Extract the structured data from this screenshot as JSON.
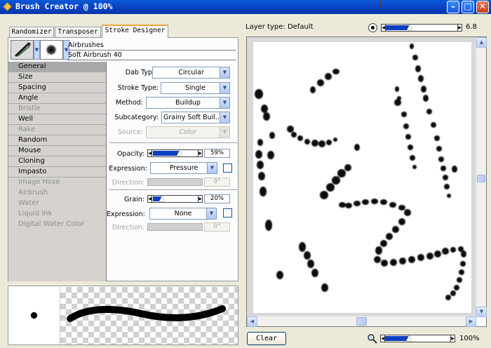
{
  "window": {
    "title": "Brush Creator @ 100%"
  },
  "tabs": [
    "Randomizer",
    "Transposer",
    "Stroke Designer"
  ],
  "brush": {
    "category": "Airbrushes",
    "variant": "Soft Airbrush 40"
  },
  "categories": [
    {
      "label": "General",
      "state": "selected"
    },
    {
      "label": "Size",
      "state": "enabled"
    },
    {
      "label": "Spacing",
      "state": "enabled"
    },
    {
      "label": "Angle",
      "state": "enabled"
    },
    {
      "label": "Bristle",
      "state": "disabled"
    },
    {
      "label": "Well",
      "state": "enabled"
    },
    {
      "label": "Rake",
      "state": "disabled"
    },
    {
      "label": "Random",
      "state": "enabled"
    },
    {
      "label": "Mouse",
      "state": "enabled"
    },
    {
      "label": "Cloning",
      "state": "enabled"
    },
    {
      "label": "Impasto",
      "state": "enabled"
    },
    {
      "label": "Image Hose",
      "state": "disabled"
    },
    {
      "label": "Airbrush",
      "state": "disabled"
    },
    {
      "label": "Water",
      "state": "disabled"
    },
    {
      "label": "Liquid Ink",
      "state": "disabled"
    },
    {
      "label": "Digital Water Color",
      "state": "disabled"
    }
  ],
  "general": {
    "dab_type_label": "Dab Type:",
    "dab_type": "Circular",
    "stroke_type_label": "Stroke Type:",
    "stroke_type": "Single",
    "method_label": "Method:",
    "method": "Buildup",
    "subcategory_label": "Subcategory:",
    "subcategory": "Grainy Soft Buil...",
    "source_label": "Source:",
    "source": "Color"
  },
  "opacity": {
    "label": "Opacity:",
    "value": "59%",
    "fraction": 0.59,
    "expression_label": "Expression:",
    "expression": "Pressure",
    "direction_label": "Direction:",
    "direction_value": "0°"
  },
  "grain": {
    "label": "Grain:",
    "value": "20%",
    "fraction": 0.2,
    "expression_label": "Expression:",
    "expression": "None",
    "direction_label": "Direction:",
    "direction_value": "0°"
  },
  "canvas": {
    "layer_type": "Layer type: Default",
    "brush_size": "6.8",
    "clear_label": "Clear",
    "zoom": "100%"
  },
  "icons": {
    "brush": "airbrush-icon",
    "dab": "soft-dab-icon",
    "size": "size-circle-icon",
    "zoom": "magnifier-icon",
    "window_min": "minimize-icon",
    "window_max": "maximize-icon",
    "window_close": "close-icon"
  },
  "colors": {
    "title_bar": "#0a3fc0",
    "slider_fill": "#0a3fc0",
    "selected_category": "#a9a9a9",
    "active_tab_accent": "#f0a53a"
  }
}
